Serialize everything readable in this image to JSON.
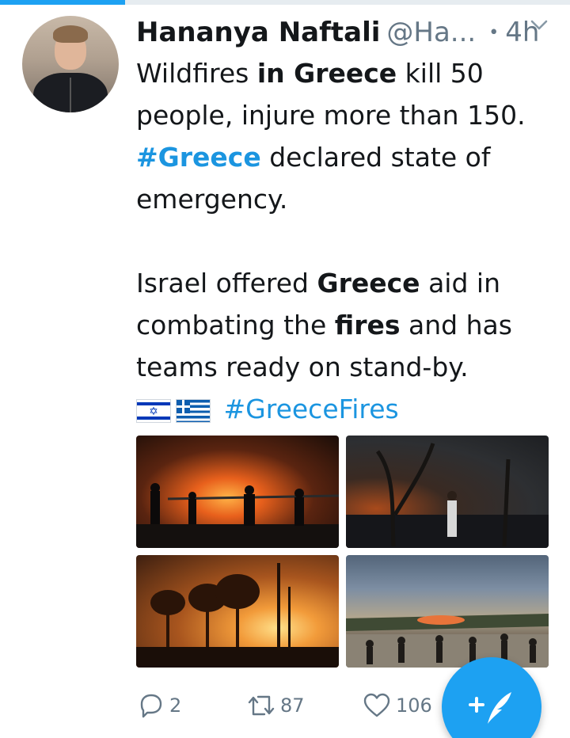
{
  "progress": {
    "fraction": 0.22,
    "color": "#1da1f2"
  },
  "tweet": {
    "author_name": "Hananya Naftali",
    "handle": "@Ha...",
    "separator": "•",
    "time": "4h",
    "menu_icon": "chevron-down-icon",
    "text": {
      "l1_a": "Wildfires ",
      "l1_b": "in Greece",
      "l1_c": " kill 50",
      "l2": "people, injure more than 150.",
      "l3_tag": "#Greece",
      "l3_rest": " declared state of",
      "l4": "emergency.",
      "l5_a": "Israel offered ",
      "l5_b": "Greece",
      "l5_c": " aid in",
      "l6_a": "combating the ",
      "l6_b": "fires",
      "l6_c": " and has",
      "l7": "teams ready on stand-by.",
      "flags": [
        "israel-flag",
        "greece-flag"
      ],
      "l8_tag": "#GreeceFires"
    },
    "media": [
      "firefighters-hose-photo",
      "man-watching-forest-fire-photo",
      "burning-trees-night-photo",
      "crowd-watching-smoke-photo"
    ],
    "actions": {
      "reply_icon": "reply-icon",
      "reply_count": "2",
      "retweet_icon": "retweet-icon",
      "retweet_count": "87",
      "like_icon": "heart-icon",
      "like_count": "106"
    }
  },
  "compose_fab": {
    "icon": "compose-feather-icon",
    "color": "#1da1f2"
  }
}
